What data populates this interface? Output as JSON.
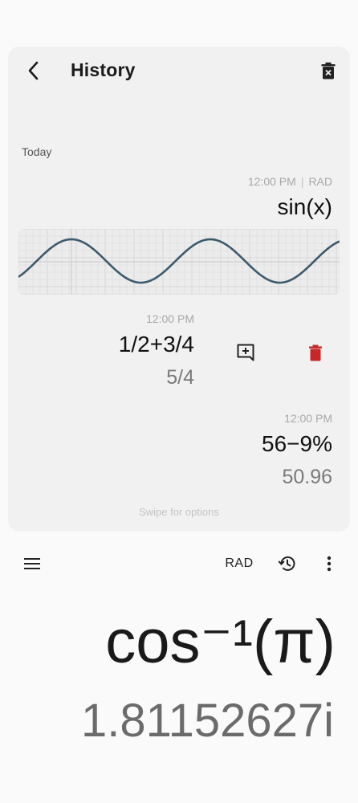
{
  "history": {
    "title": "History",
    "section_label": "Today",
    "items": [
      {
        "time": "12:00 PM",
        "mode": "RAD",
        "expression": "sin(x)",
        "result": ""
      },
      {
        "time": "12:00 PM",
        "expression": "1/2+3/4",
        "result": "5/4"
      },
      {
        "time": "12:00 PM",
        "expression": "56−9%",
        "result": "50.96"
      }
    ],
    "swipe_hint": "Swipe for options"
  },
  "toolbar": {
    "angle_mode": "RAD"
  },
  "display": {
    "expression": "cos⁻¹(π)",
    "result": "1.81152627i"
  },
  "icons": {
    "back": "back-arrow-icon",
    "clear_history": "trash-icon",
    "insert": "add-comment-icon",
    "delete": "trash-icon",
    "menu": "hamburger-icon",
    "history": "history-icon",
    "more": "more-vertical-icon"
  },
  "colors": {
    "delete_red": "#c62828",
    "graph_line": "#3d5a6c"
  }
}
